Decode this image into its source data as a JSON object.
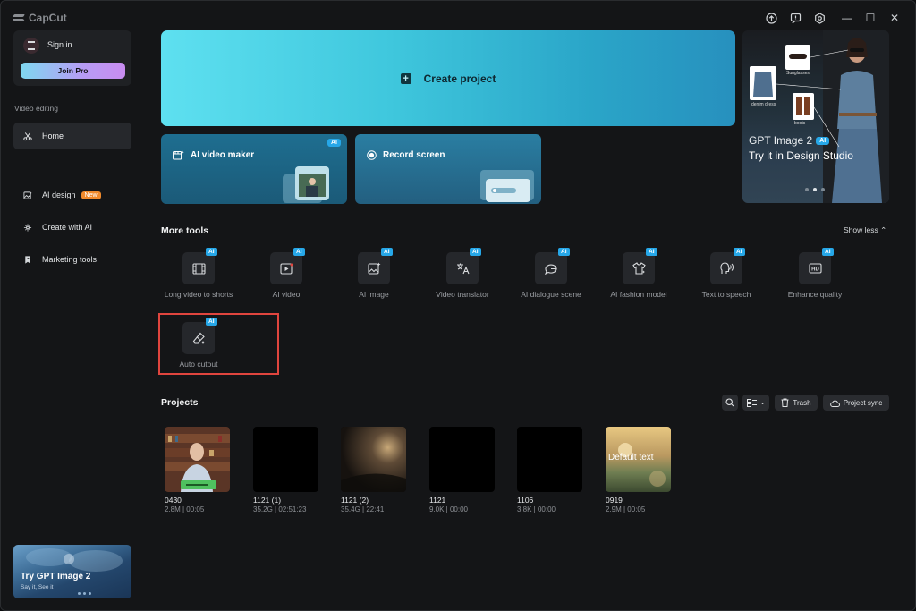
{
  "app": {
    "name": "CapCut"
  },
  "window_controls": {
    "minimize": "—",
    "maximize": "☐",
    "close": "✕"
  },
  "sidebar": {
    "signin": "Sign in",
    "join_pro": "Join Pro",
    "section": "Video editing",
    "home": "Home",
    "items": [
      {
        "label": "AI design",
        "badge": "New",
        "icon": "image-edit-icon"
      },
      {
        "label": "Create with AI",
        "icon": "sparkle-icon"
      },
      {
        "label": "Marketing tools",
        "icon": "marketing-icon"
      }
    ],
    "promo": {
      "title": "Try GPT Image 2",
      "subtitle": "Say it, See it"
    }
  },
  "create": {
    "label": "Create project"
  },
  "ai_maker": {
    "label": "AI video maker",
    "badge": "AI"
  },
  "record": {
    "label": "Record screen"
  },
  "banner": {
    "title": "GPT Image 2",
    "badge": "AI",
    "subtitle": "Try it in Design Studio",
    "tags": [
      "Sunglasses",
      "denim dress",
      "boots"
    ]
  },
  "more_tools": {
    "title": "More tools",
    "show_less": "Show less",
    "badge": "AI",
    "tools": [
      {
        "label": "Long video to shorts",
        "icon": "film-icon"
      },
      {
        "label": "AI video",
        "icon": "play-icon"
      },
      {
        "label": "AI image",
        "icon": "image-icon"
      },
      {
        "label": "Video translator",
        "icon": "translate-icon"
      },
      {
        "label": "AI dialogue scene",
        "icon": "dialogue-icon"
      },
      {
        "label": "AI fashion model",
        "icon": "shirt-icon"
      },
      {
        "label": "Text to speech",
        "icon": "speech-icon"
      },
      {
        "label": "Enhance quality",
        "icon": "hd-icon"
      },
      {
        "label": "Auto cutout",
        "icon": "eraser-icon"
      }
    ]
  },
  "projects": {
    "title": "Projects",
    "trash": "Trash",
    "sync": "Project sync",
    "items": [
      {
        "name": "0430",
        "meta": "2.8M | 00:05"
      },
      {
        "name": "1121 (1)",
        "meta": "35.2G | 02:51:23"
      },
      {
        "name": "1121 (2)",
        "meta": "35.4G | 22:41"
      },
      {
        "name": "1121",
        "meta": "9.0K | 00:00"
      },
      {
        "name": "1106",
        "meta": "3.8K | 00:00"
      },
      {
        "name": "0919",
        "meta": "2.9M | 00:05",
        "overlay": "Default text"
      }
    ]
  }
}
